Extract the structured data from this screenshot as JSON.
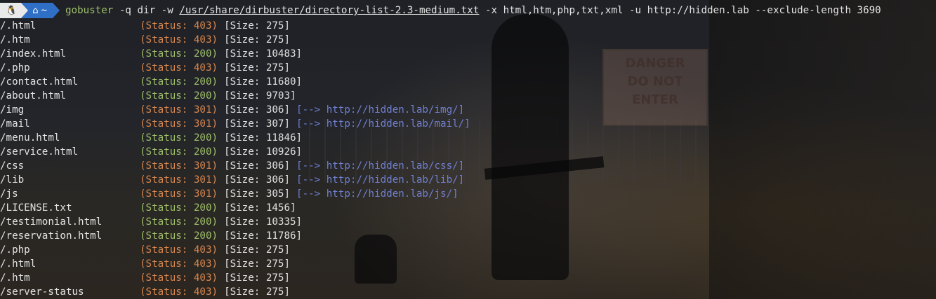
{
  "prompt": {
    "os_icon": "linux-tux-icon",
    "home_icon": "home-icon",
    "dir_label": "~",
    "command_name": "gobuster",
    "args_1": " -q dir -w ",
    "wordlist": "/usr/share/dirbuster/directory-list-2.3-medium.txt",
    "args_2": " -x html,htm,php,txt,xml -u http://hidden.lab --exclude-length 3690"
  },
  "results": [
    {
      "path": "/.html",
      "status": "Status: 403",
      "code": "403",
      "size": "[Size: 275]",
      "redirect": ""
    },
    {
      "path": "/.htm",
      "status": "Status: 403",
      "code": "403",
      "size": "[Size: 275]",
      "redirect": ""
    },
    {
      "path": "/index.html",
      "status": "Status: 200",
      "code": "200",
      "size": "[Size: 10483]",
      "redirect": ""
    },
    {
      "path": "/.php",
      "status": "Status: 403",
      "code": "403",
      "size": "[Size: 275]",
      "redirect": ""
    },
    {
      "path": "/contact.html",
      "status": "Status: 200",
      "code": "200",
      "size": "[Size: 11680]",
      "redirect": ""
    },
    {
      "path": "/about.html",
      "status": "Status: 200",
      "code": "200",
      "size": "[Size: 9703]",
      "redirect": ""
    },
    {
      "path": "/img",
      "status": "Status: 301",
      "code": "301",
      "size": "[Size: 306]",
      "redirect": "[--> http://hidden.lab/img/]"
    },
    {
      "path": "/mail",
      "status": "Status: 301",
      "code": "301",
      "size": "[Size: 307]",
      "redirect": "[--> http://hidden.lab/mail/]"
    },
    {
      "path": "/menu.html",
      "status": "Status: 200",
      "code": "200",
      "size": "[Size: 11846]",
      "redirect": ""
    },
    {
      "path": "/service.html",
      "status": "Status: 200",
      "code": "200",
      "size": "[Size: 10926]",
      "redirect": ""
    },
    {
      "path": "/css",
      "status": "Status: 301",
      "code": "301",
      "size": "[Size: 306]",
      "redirect": "[--> http://hidden.lab/css/]"
    },
    {
      "path": "/lib",
      "status": "Status: 301",
      "code": "301",
      "size": "[Size: 306]",
      "redirect": "[--> http://hidden.lab/lib/]"
    },
    {
      "path": "/js",
      "status": "Status: 301",
      "code": "301",
      "size": "[Size: 305]",
      "redirect": "[--> http://hidden.lab/js/]"
    },
    {
      "path": "/LICENSE.txt",
      "status": "Status: 200",
      "code": "200",
      "size": "[Size: 1456]",
      "redirect": ""
    },
    {
      "path": "/testimonial.html",
      "status": "Status: 200",
      "code": "200",
      "size": "[Size: 10335]",
      "redirect": ""
    },
    {
      "path": "/reservation.html",
      "status": "Status: 200",
      "code": "200",
      "size": "[Size: 11786]",
      "redirect": ""
    },
    {
      "path": "/.php",
      "status": "Status: 403",
      "code": "403",
      "size": "[Size: 275]",
      "redirect": ""
    },
    {
      "path": "/.html",
      "status": "Status: 403",
      "code": "403",
      "size": "[Size: 275]",
      "redirect": ""
    },
    {
      "path": "/.htm",
      "status": "Status: 403",
      "code": "403",
      "size": "[Size: 275]",
      "redirect": ""
    },
    {
      "path": "/server-status",
      "status": "Status: 403",
      "code": "403",
      "size": "[Size: 275]",
      "redirect": ""
    }
  ],
  "background_sign": {
    "line1": "DANGER",
    "line2": "DO NOT",
    "line3": "ENTER"
  },
  "colors": {
    "status_200": "#9fbf6a",
    "status_301_403": "#d7874f",
    "redirect": "#6f7fd0",
    "prompt_dir_bg": "#2f6fc6"
  }
}
